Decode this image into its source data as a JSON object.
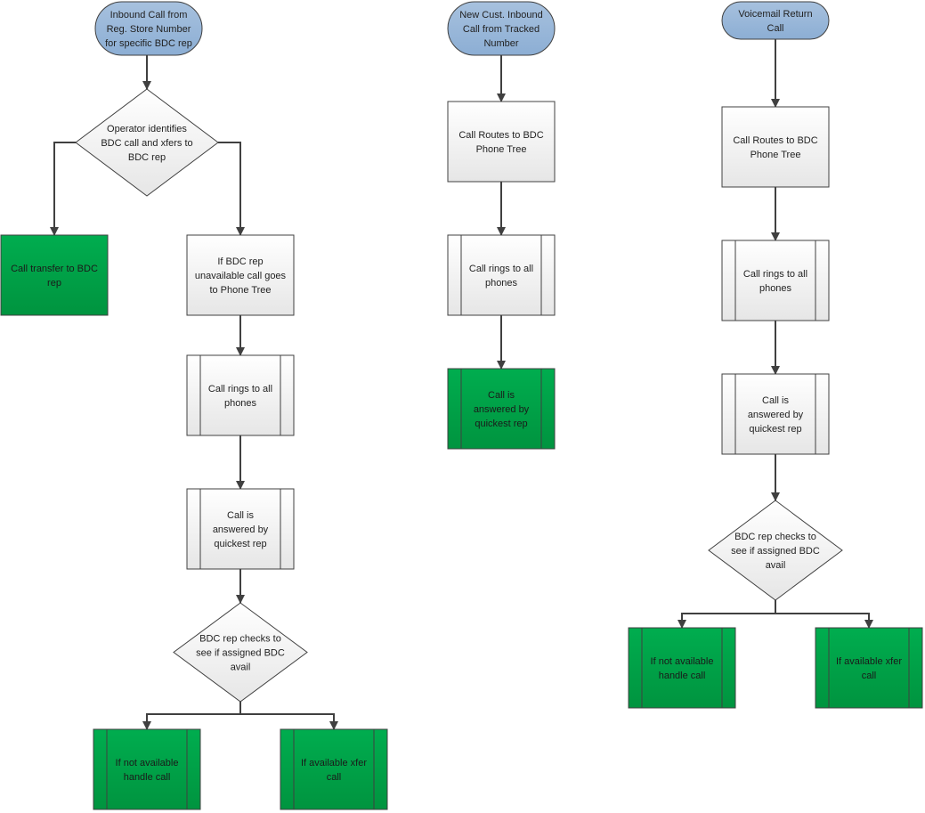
{
  "colors": {
    "terminator": "#95b3d7",
    "process": "#f2f2f2",
    "success": "#00a651",
    "edge": "#404040"
  },
  "nodes": {
    "c1_start": [
      "Inbound Call from",
      "Reg. Store Number",
      "for specific BDC rep"
    ],
    "c1_decision": [
      "Operator identifies",
      "BDC call and xfers to",
      "BDC rep"
    ],
    "c1_transfer": [
      "Call transfer to BDC",
      "rep"
    ],
    "c1_unavailable": [
      "If BDC rep",
      "unavailable call goes",
      "to Phone Tree"
    ],
    "c1_rings": [
      "Call rings to all",
      "phones"
    ],
    "c1_answered": [
      "Call is",
      "answered by",
      "quickest rep"
    ],
    "c1_check": [
      "BDC rep checks to",
      "see if assigned BDC",
      "avail"
    ],
    "c1_handle": [
      "If not available",
      "handle call"
    ],
    "c1_xfer": [
      "If available xfer",
      "call"
    ],
    "c2_start": [
      "New Cust. Inbound",
      "Call from Tracked",
      "Number"
    ],
    "c2_routes": [
      "Call Routes to BDC",
      "Phone Tree"
    ],
    "c2_rings": [
      "Call rings to all",
      "phones"
    ],
    "c2_answered": [
      "Call is",
      "answered by",
      "quickest rep"
    ],
    "c3_start": [
      "Voicemail Return",
      "Call"
    ],
    "c3_routes": [
      "Call Routes to BDC",
      "Phone Tree"
    ],
    "c3_rings": [
      "Call rings to all",
      "phones"
    ],
    "c3_answered": [
      "Call is",
      "answered by",
      "quickest rep"
    ],
    "c3_check": [
      "BDC rep checks to",
      "see if assigned BDC",
      "avail"
    ],
    "c3_handle": [
      "If not available",
      "handle call"
    ],
    "c3_xfer": [
      "If available xfer",
      "call"
    ]
  }
}
